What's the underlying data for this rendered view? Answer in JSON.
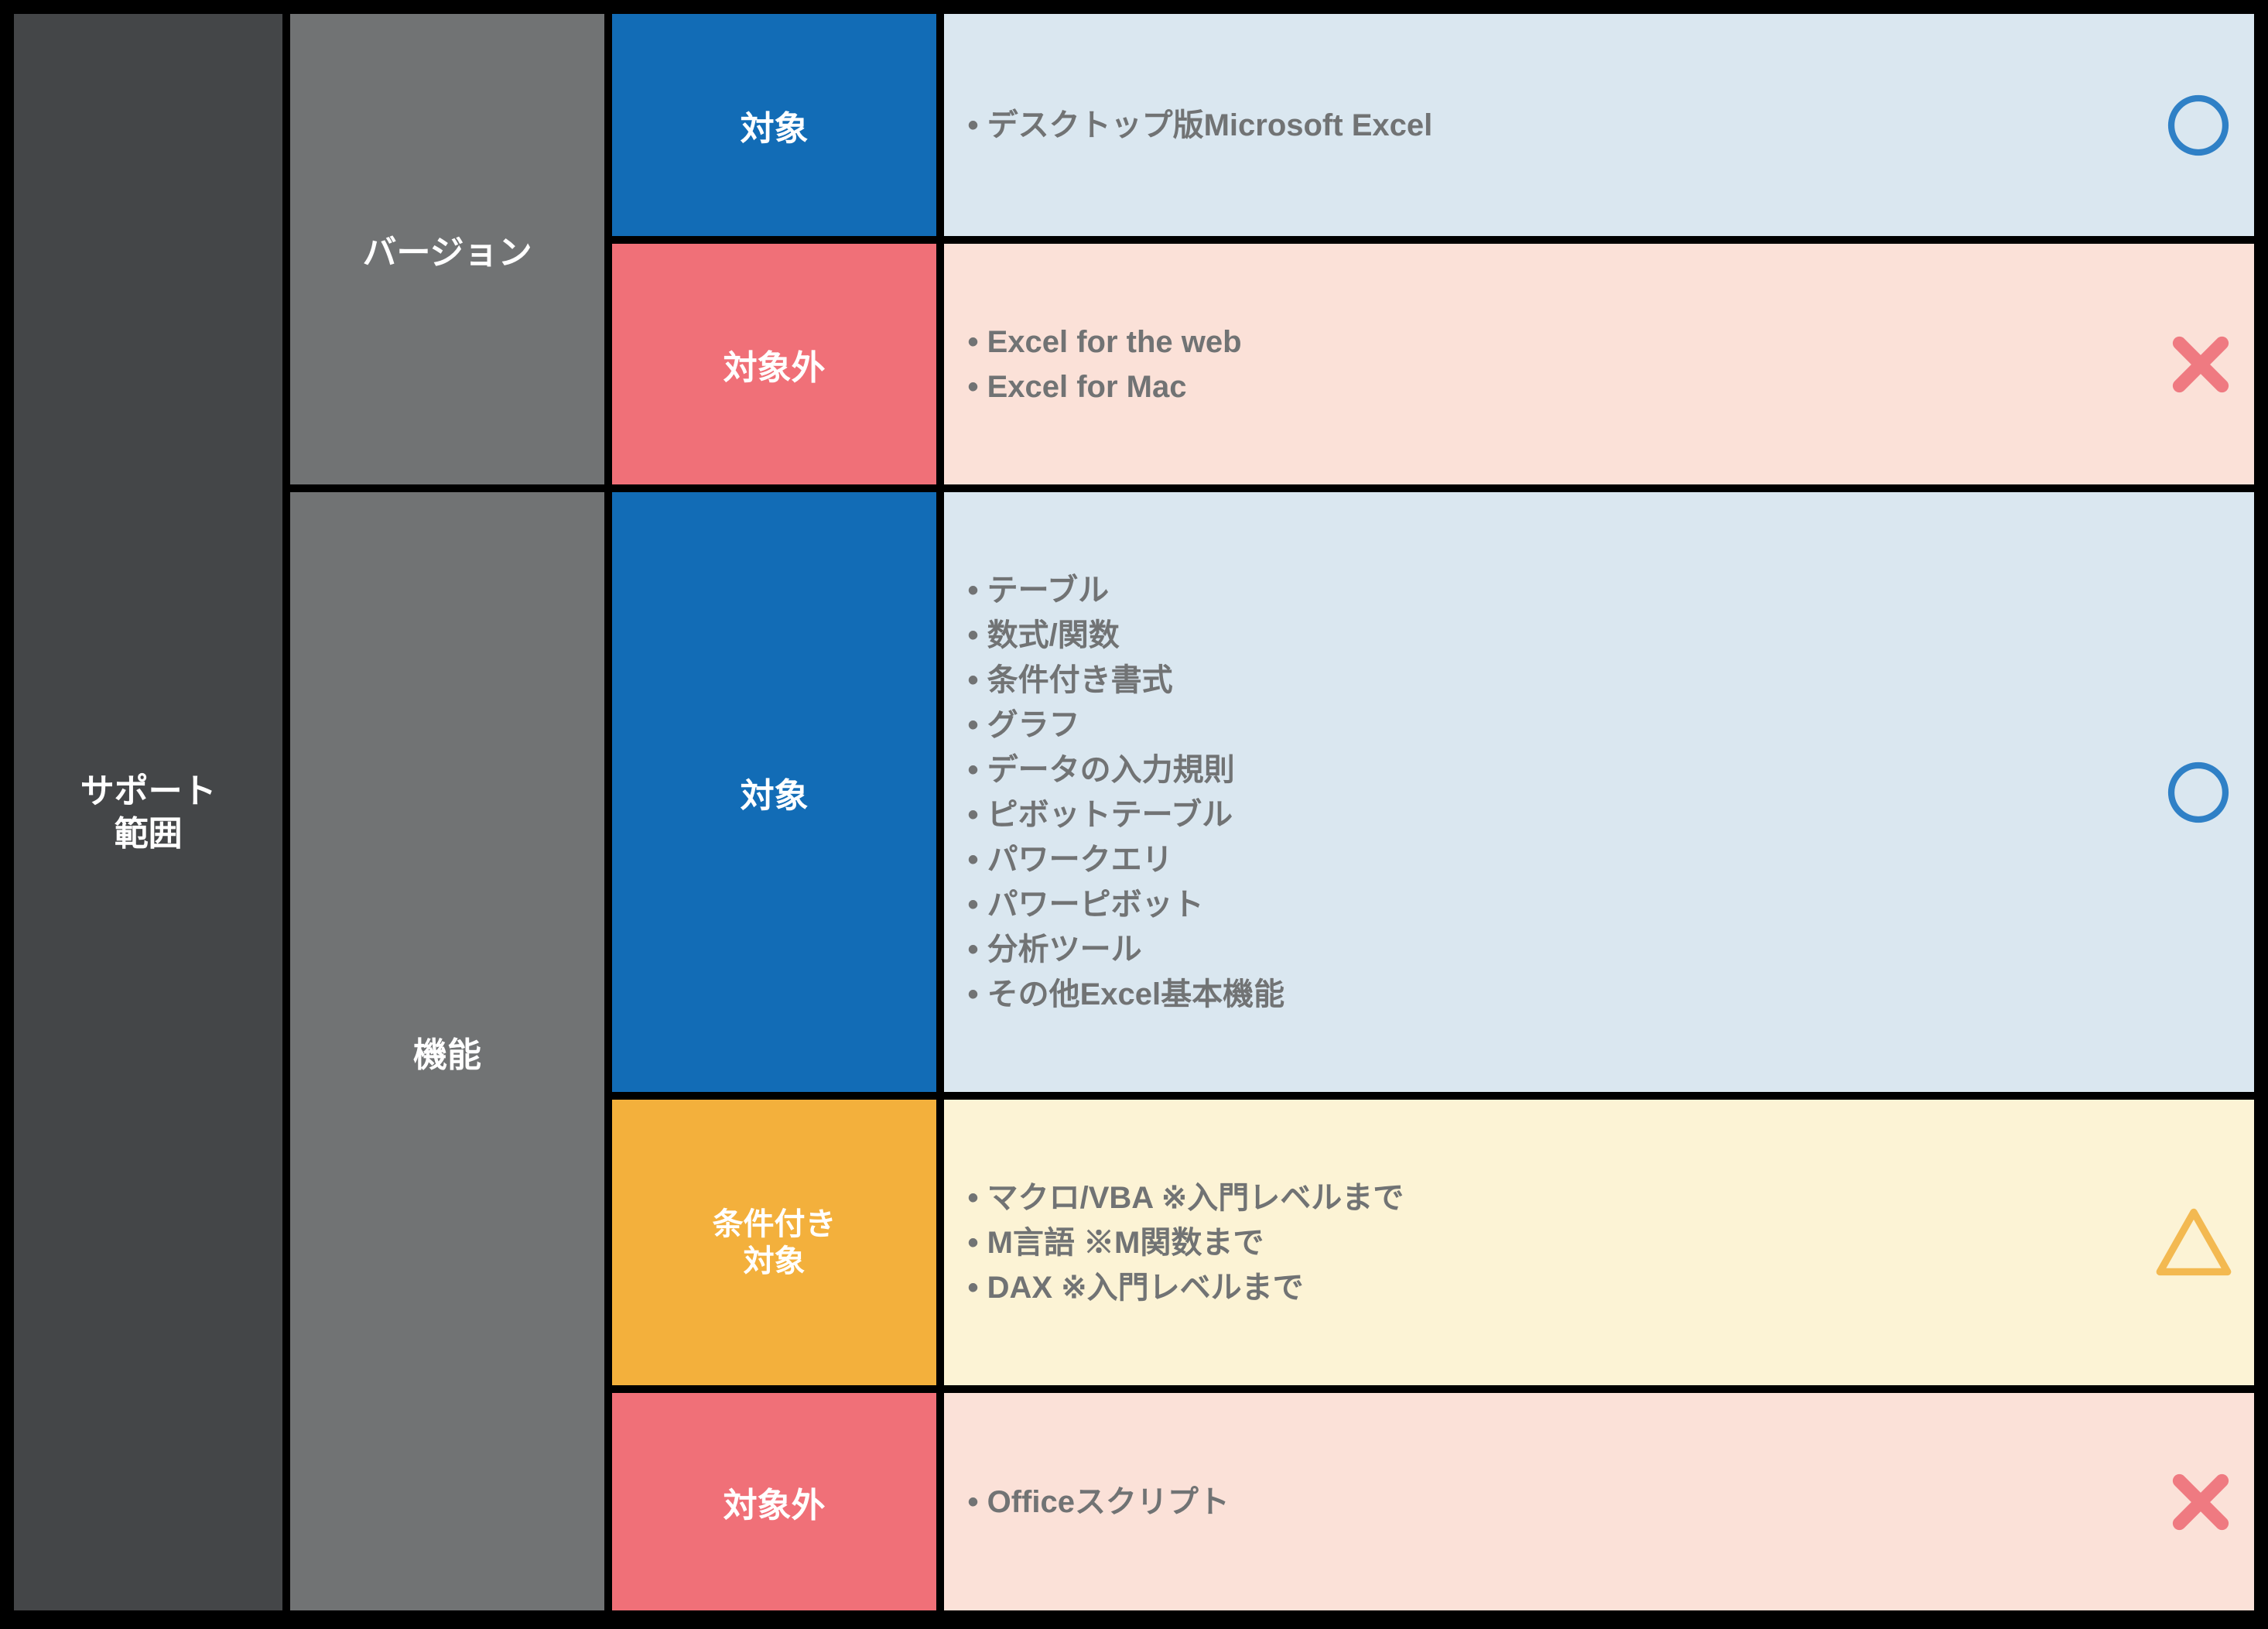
{
  "scope_label": "サポート\n範囲",
  "groups": {
    "version": {
      "label": "バージョン",
      "rows": [
        {
          "status_label": "対象",
          "status": "in",
          "items": [
            "デスクトップ版Microsoft Excel"
          ]
        },
        {
          "status_label": "対象外",
          "status": "out",
          "items": [
            "Excel for the web",
            "Excel for Mac"
          ]
        }
      ]
    },
    "feature": {
      "label": "機能",
      "rows": [
        {
          "status_label": "対象",
          "status": "in",
          "items": [
            "テーブル",
            "数式/関数",
            "条件付き書式",
            "グラフ",
            "データの入力規則",
            "ピボットテーブル",
            "パワークエリ",
            "パワーピボット",
            "分析ツール",
            "その他Excel基本機能"
          ]
        },
        {
          "status_label": "条件付き\n対象",
          "status": "cond",
          "items": [
            "マクロ/VBA ※入門レベルまで",
            "M言語 ※M関数まで",
            "DAX ※入門レベルまで"
          ]
        },
        {
          "status_label": "対象外",
          "status": "out",
          "items": [
            "Officeスクリプト"
          ]
        }
      ]
    }
  },
  "colors": {
    "in": {
      "label_bg": "#126cb6",
      "content_bg": "#dae7f0",
      "mark": "#2f80c6"
    },
    "cond": {
      "label_bg": "#f3b03c",
      "content_bg": "#fcf3d5",
      "mark": "#f3b951"
    },
    "out": {
      "label_bg": "#f07078",
      "content_bg": "#fbe1d8",
      "mark": "#ef7a81"
    }
  }
}
